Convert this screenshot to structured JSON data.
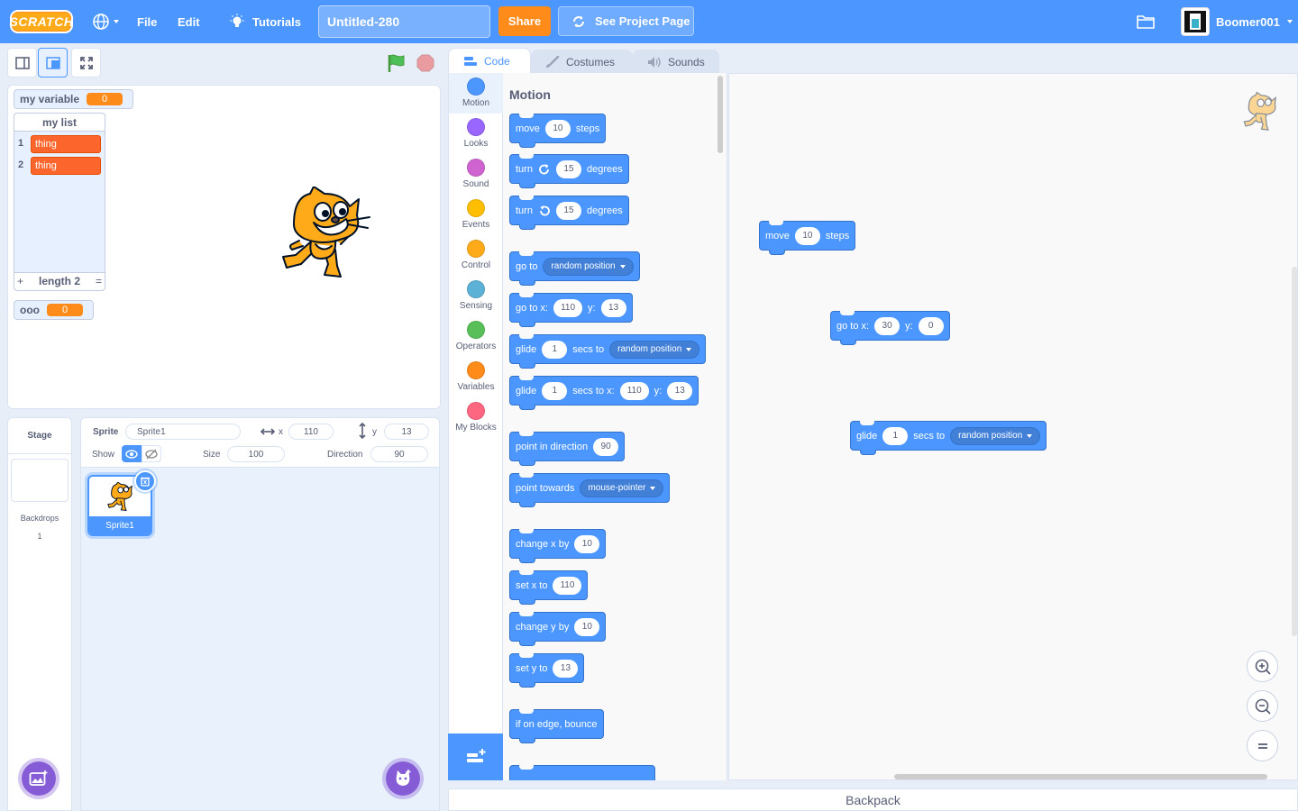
{
  "menubar": {
    "logo": "SCRATCH",
    "file": "File",
    "edit": "Edit",
    "tutorials": "Tutorials",
    "project_title": "Untitled-280",
    "share": "Share",
    "see_project": "See Project Page",
    "username": "Boomer001"
  },
  "stage": {
    "variable_name": "my variable",
    "variable_value": "0",
    "list_title": "my list",
    "list_items": [
      {
        "index": "1",
        "value": "thing"
      },
      {
        "index": "2",
        "value": "thing"
      }
    ],
    "list_add": "+",
    "list_length": "length 2",
    "list_resize": "=",
    "var2_name": "ooo",
    "var2_value": "0"
  },
  "sprite_info": {
    "sprite_label": "Sprite",
    "sprite_name": "Sprite1",
    "x_label": "x",
    "x_value": "110",
    "y_label": "y",
    "y_value": "13",
    "show_label": "Show",
    "size_label": "Size",
    "size_value": "100",
    "direction_label": "Direction",
    "direction_value": "90"
  },
  "sprite_list": [
    {
      "name": "Sprite1",
      "selected": true
    }
  ],
  "stage_panel": {
    "title": "Stage",
    "backdrops_label": "Backdrops",
    "backdrops_count": "1"
  },
  "tabs": {
    "code": "Code",
    "costumes": "Costumes",
    "sounds": "Sounds"
  },
  "categories": [
    {
      "label": "Motion",
      "color": "#4c97ff"
    },
    {
      "label": "Looks",
      "color": "#9966ff"
    },
    {
      "label": "Sound",
      "color": "#cf63cf"
    },
    {
      "label": "Events",
      "color": "#ffbf00"
    },
    {
      "label": "Control",
      "color": "#ffab19"
    },
    {
      "label": "Sensing",
      "color": "#5cb1d6"
    },
    {
      "label": "Operators",
      "color": "#59c059"
    },
    {
      "label": "Variables",
      "color": "#ff8c1a"
    },
    {
      "label": "My Blocks",
      "color": "#ff6680"
    }
  ],
  "palette": {
    "heading": "Motion",
    "move": {
      "a": "move",
      "n": "10",
      "b": "steps"
    },
    "turn_right": {
      "a": "turn",
      "n": "15",
      "b": "degrees"
    },
    "turn_left": {
      "a": "turn",
      "n": "15",
      "b": "degrees"
    },
    "goto": {
      "a": "go to",
      "menu": "random position"
    },
    "goto_xy": {
      "a": "go to x:",
      "x": "110",
      "yl": "y:",
      "y": "13"
    },
    "glide_to": {
      "a": "glide",
      "n": "1",
      "b": "secs to",
      "menu": "random position"
    },
    "glide_xy": {
      "a": "glide",
      "n": "1",
      "b": "secs to x:",
      "x": "110",
      "yl": "y:",
      "y": "13"
    },
    "point_dir": {
      "a": "point in direction",
      "n": "90"
    },
    "point_towards": {
      "a": "point towards",
      "menu": "mouse-pointer"
    },
    "change_x": {
      "a": "change x by",
      "n": "10"
    },
    "set_x": {
      "a": "set x to",
      "n": "110"
    },
    "change_y": {
      "a": "change y by",
      "n": "10"
    },
    "set_y": {
      "a": "set y to",
      "n": "13"
    },
    "bounce": {
      "a": "if on edge, bounce"
    }
  },
  "workspace": {
    "move": {
      "a": "move",
      "n": "10",
      "b": "steps"
    },
    "goto_xy": {
      "a": "go to x:",
      "x": "30",
      "yl": "y:",
      "y": "0"
    },
    "glide_to": {
      "a": "glide",
      "n": "1",
      "b": "secs to",
      "menu": "random position"
    }
  },
  "backpack": "Backpack",
  "colors": {
    "menubar": "#4c97ff",
    "motion": "#4c97ff",
    "share": "#ff8c1a",
    "variable": "#ff8c1a",
    "list_item": "#fc662c"
  }
}
